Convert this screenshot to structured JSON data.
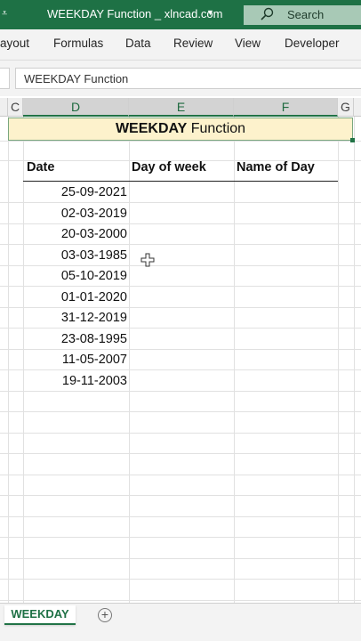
{
  "window": {
    "title": "WEEKDAY Function _ xlncad.com",
    "search_label": "Search"
  },
  "ribbon": {
    "tabs": [
      "ayout",
      "Formulas",
      "Data",
      "Review",
      "View",
      "Developer"
    ]
  },
  "formula_bar": {
    "value": "WEEKDAY Function"
  },
  "columns": [
    "C",
    "D",
    "E",
    "F",
    "G"
  ],
  "sheet": {
    "title_bold": "WEEKDAY",
    "title_rest": " Function",
    "headers": [
      "Date",
      "Day of week",
      "Name of Day"
    ],
    "dates": [
      "25-09-2021",
      "02-03-2019",
      "20-03-2000",
      "03-03-1985",
      "05-10-2019",
      "01-01-2020",
      "31-12-2019",
      "23-08-1995",
      "11-05-2007",
      "19-11-2003"
    ]
  },
  "sheet_tabs": {
    "active": "WEEKDAY",
    "add_label": "+"
  },
  "colors": {
    "accent": "#1e7145",
    "title_fill": "#fdf2cc"
  }
}
